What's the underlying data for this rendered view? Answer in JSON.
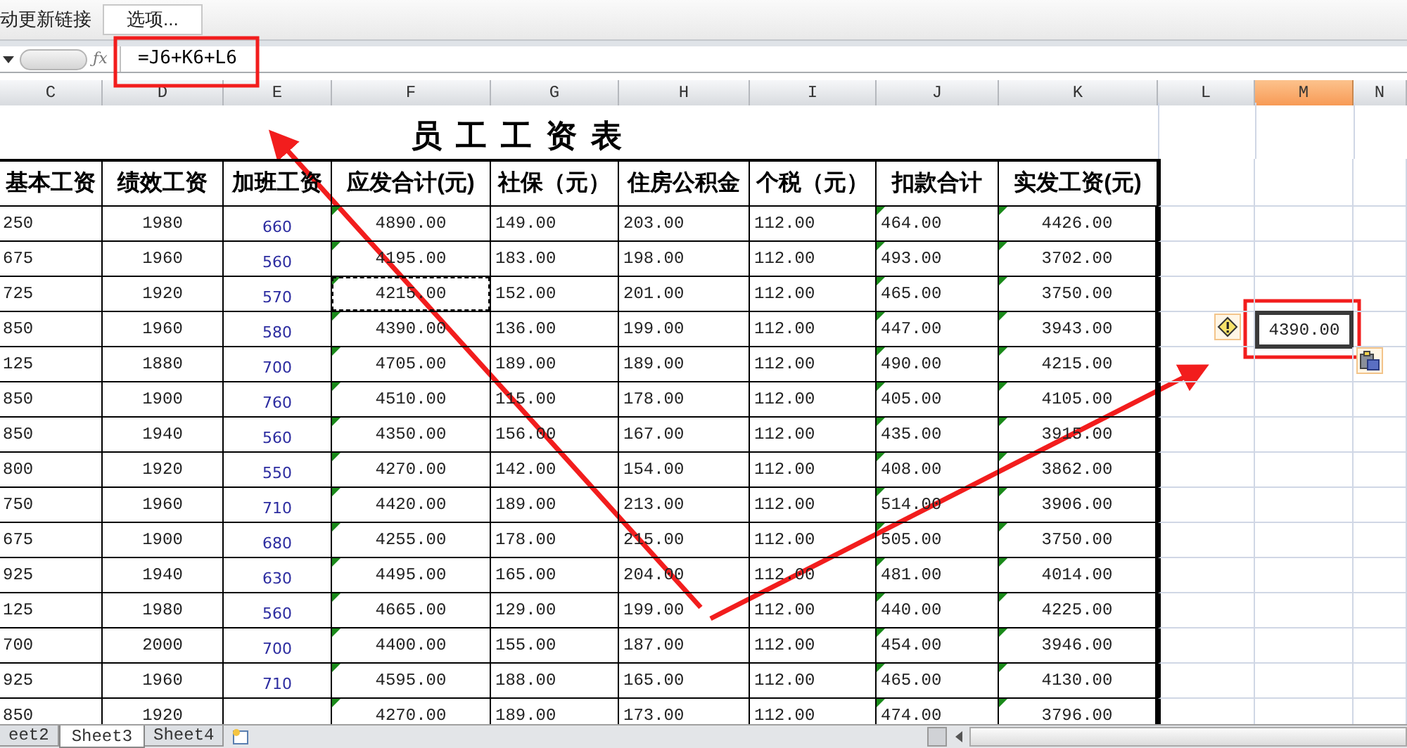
{
  "toolbar": {
    "label": "动更新链接",
    "button": "选项..."
  },
  "formula_bar": {
    "fx_label": "ƒx",
    "formula": "=J6+K6+L6"
  },
  "columns": [
    {
      "label": "C",
      "selected": false
    },
    {
      "label": "D",
      "selected": false
    },
    {
      "label": "E",
      "selected": false
    },
    {
      "label": "F",
      "selected": false,
      "flagged": true
    },
    {
      "label": "G",
      "selected": false
    },
    {
      "label": "H",
      "selected": false
    },
    {
      "label": "I",
      "selected": false
    },
    {
      "label": "J",
      "selected": false,
      "flagged": true
    },
    {
      "label": "K",
      "selected": false,
      "flagged": true
    },
    {
      "label": "L",
      "selected": false
    },
    {
      "label": "M",
      "selected": true
    },
    {
      "label": "N",
      "selected": false
    }
  ],
  "sheet_title": "员工工资表",
  "table": {
    "headers": [
      "基本工资",
      "绩效工资",
      "加班工资",
      "应发合计(元)",
      "社保（元）",
      "住房公积金",
      "个税（元）",
      "扣款合计",
      "实发工资(元)"
    ],
    "rows": [
      {
        "cells": {
          "C": "250",
          "D": "1980",
          "E": "660",
          "F": "4890.00",
          "G": "149.00",
          "H": "203.00",
          "I": "112.00",
          "J": "464.00",
          "K": "4426.00"
        }
      },
      {
        "cells": {
          "C": "675",
          "D": "1960",
          "E": "560",
          "F": "4195.00",
          "G": "183.00",
          "H": "198.00",
          "I": "112.00",
          "J": "493.00",
          "K": "3702.00"
        }
      },
      {
        "cells": {
          "C": "725",
          "D": "1920",
          "E": "570",
          "F": {
            "value": "4215.00",
            "marquee": true
          },
          "G": "152.00",
          "H": "201.00",
          "I": "112.00",
          "J": "465.00",
          "K": "3750.00"
        }
      },
      {
        "cells": {
          "C": "850",
          "D": "1960",
          "E": "580",
          "F": "4390.00",
          "G": "136.00",
          "H": "199.00",
          "I": "112.00",
          "J": "447.00",
          "K": "3943.00",
          "M": "4390.00"
        },
        "warning": true
      },
      {
        "cells": {
          "C": "125",
          "D": "1880",
          "E": "700",
          "F": "4705.00",
          "G": "189.00",
          "H": "189.00",
          "I": "112.00",
          "J": "490.00",
          "K": "4215.00"
        },
        "paste_options": true
      },
      {
        "cells": {
          "C": "850",
          "D": "1900",
          "E": "760",
          "F": "4510.00",
          "G": "115.00",
          "H": "178.00",
          "I": "112.00",
          "J": "405.00",
          "K": "4105.00"
        }
      },
      {
        "cells": {
          "C": "850",
          "D": "1940",
          "E": "560",
          "F": "4350.00",
          "G": "156.00",
          "H": "167.00",
          "I": "112.00",
          "J": "435.00",
          "K": "3915.00"
        }
      },
      {
        "cells": {
          "C": "800",
          "D": "1920",
          "E": "550",
          "F": "4270.00",
          "G": "142.00",
          "H": "154.00",
          "I": "112.00",
          "J": "408.00",
          "K": "3862.00"
        }
      },
      {
        "cells": {
          "C": "750",
          "D": "1960",
          "E": "710",
          "F": "4420.00",
          "G": "189.00",
          "H": "213.00",
          "I": "112.00",
          "J": "514.00",
          "K": "3906.00"
        }
      },
      {
        "cells": {
          "C": "675",
          "D": "1900",
          "E": "680",
          "F": "4255.00",
          "G": "178.00",
          "H": "215.00",
          "I": "112.00",
          "J": "505.00",
          "K": "3750.00"
        }
      },
      {
        "cells": {
          "C": "925",
          "D": "1940",
          "E": "630",
          "F": "4495.00",
          "G": "165.00",
          "H": "204.00",
          "I": "112.00",
          "J": "481.00",
          "K": "4014.00"
        }
      },
      {
        "cells": {
          "C": "125",
          "D": "1980",
          "E": "560",
          "F": "4665.00",
          "G": "129.00",
          "H": "199.00",
          "I": "112.00",
          "J": "440.00",
          "K": "4225.00"
        }
      },
      {
        "cells": {
          "C": "700",
          "D": "2000",
          "E": "700",
          "F": "4400.00",
          "G": "155.00",
          "H": "187.00",
          "I": "112.00",
          "J": "454.00",
          "K": "3946.00"
        }
      },
      {
        "cells": {
          "C": "925",
          "D": "1960",
          "E": "710",
          "F": "4595.00",
          "G": "188.00",
          "H": "165.00",
          "I": "112.00",
          "J": "465.00",
          "K": "4130.00"
        }
      },
      {
        "cells": {
          "C": "850",
          "D": "1920",
          "F": "4270.00",
          "G": "189.00",
          "H": "173.00",
          "I": "112.00",
          "J": "474.00",
          "K": "3796.00"
        }
      }
    ]
  },
  "sheet_tabs": [
    {
      "label": "eet2",
      "selected": false
    },
    {
      "label": "Sheet3",
      "selected": true
    },
    {
      "label": "Sheet4",
      "selected": false
    }
  ]
}
